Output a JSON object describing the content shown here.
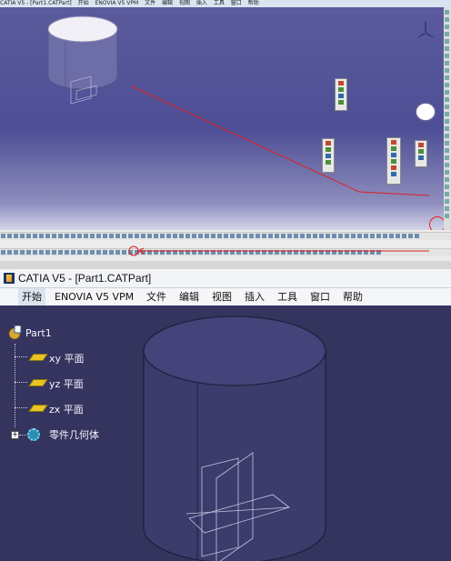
{
  "top_panel": {
    "title_items": [
      "CATIA V5 - [Part1.CATPart]",
      "开始",
      "ENOVIA V5 VPM",
      "文件",
      "编辑",
      "视图",
      "插入",
      "工具",
      "窗口",
      "帮助"
    ],
    "colors": {
      "annotation": "#e02020",
      "viewport_top": "#5a5a9c",
      "viewport_bottom": "#d4d4e8"
    }
  },
  "window": {
    "title": "CATIA V5 - [Part1.CATPart]",
    "app_icon": "catia-logo-icon"
  },
  "menu": {
    "items": [
      {
        "label": "开始",
        "active": true
      },
      {
        "label": "ENOVIA V5 VPM",
        "active": false
      },
      {
        "label": "文件",
        "active": false
      },
      {
        "label": "编辑",
        "active": false
      },
      {
        "label": "视图",
        "active": false
      },
      {
        "label": "插入",
        "active": false
      },
      {
        "label": "工具",
        "active": false
      },
      {
        "label": "窗口",
        "active": false
      },
      {
        "label": "帮助",
        "active": false
      }
    ]
  },
  "tree": {
    "root": {
      "label": "Part1",
      "icon": "part-icon"
    },
    "children": [
      {
        "label": "xy 平面",
        "icon": "plane-icon"
      },
      {
        "label": "yz 平面",
        "icon": "plane-icon"
      },
      {
        "label": "zx 平面",
        "icon": "plane-icon"
      },
      {
        "label": "零件几何体",
        "icon": "body-gear-icon",
        "expandable": true
      }
    ]
  },
  "colors": {
    "viewport_bg": "#34345e",
    "cylinder_fill": "#3c3c6c",
    "cylinder_top": "#44447a",
    "plane_icon": "#e8c522",
    "tree_text": "#f4f4ff"
  }
}
